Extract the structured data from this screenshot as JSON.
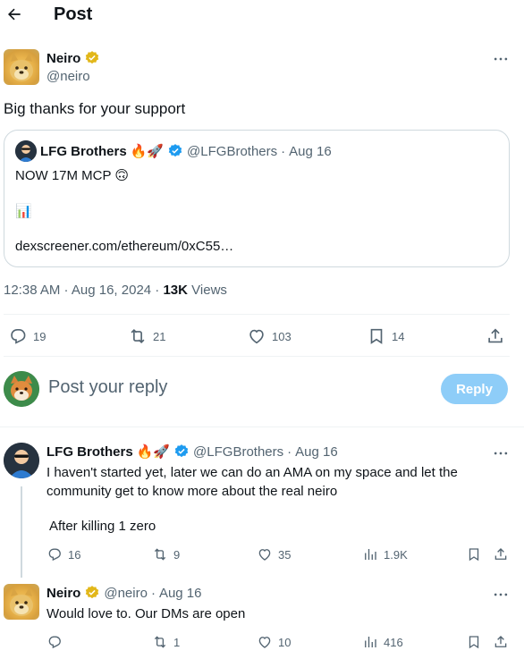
{
  "header": {
    "title": "Post"
  },
  "post": {
    "author_name": "Neiro",
    "author_handle": "@neiro",
    "text": "Big thanks for your support",
    "quote": {
      "author_name": "LFG Brothers",
      "emoji": "🔥🚀",
      "author_handle": "@LFGBrothers",
      "sep": "·",
      "date": "Aug 16",
      "line1": "NOW 17M MCP 🙃",
      "line2": "📊",
      "link": "dexscreener.com/ethereum/0xC55…"
    },
    "timestamp": "12:38 AM · Aug 16, 2024 · ",
    "views_count": "13K",
    "views_label": " Views",
    "stats": {
      "replies": "19",
      "reposts": "21",
      "likes": "103",
      "bookmarks": "14"
    }
  },
  "composer": {
    "placeholder": "Post your reply",
    "button": "Reply"
  },
  "replies": [
    {
      "author_name": "LFG Brothers",
      "emoji": "🔥🚀",
      "author_handle": "@LFGBrothers",
      "sep": "·",
      "date": "Aug 16",
      "text1": "I haven't started yet, later we can do an AMA on my space and let the",
      "text2": "community get to know more about the real neiro",
      "text3": "After killing 1 zero",
      "stats": {
        "replies": "16",
        "reposts": "9",
        "likes": "35",
        "views": "1.9K"
      }
    },
    {
      "author_name": "Neiro",
      "author_handle": "@neiro",
      "sep": "·",
      "date": "Aug 16",
      "text1": "Would love to. Our DMs are open",
      "stats": {
        "replies": "",
        "reposts": "1",
        "likes": "10",
        "views": "416"
      }
    }
  ],
  "colors": {
    "accent": "#1d9bf0",
    "reply_button": "#8ecdf8",
    "verified_gold": "#e2b719",
    "muted": "#536471"
  }
}
